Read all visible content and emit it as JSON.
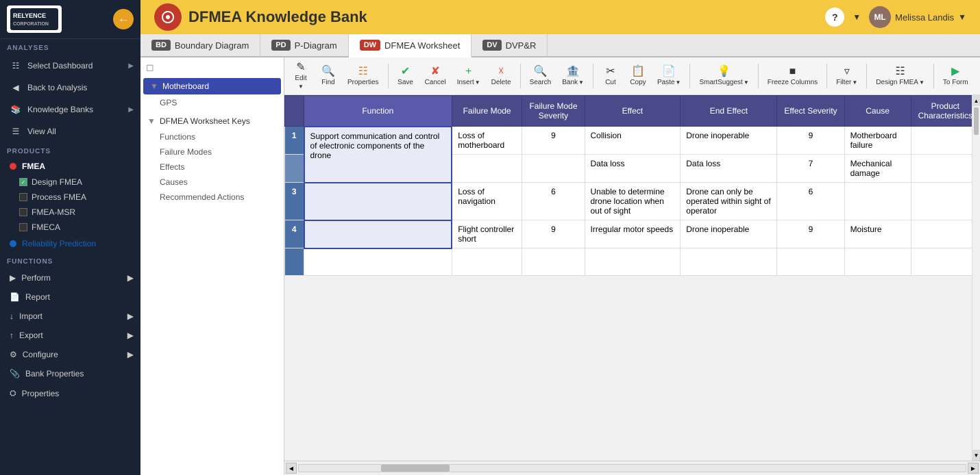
{
  "app": {
    "title": "DFMEA Knowledge Bank",
    "logo_text": "RELYENCE CORPORATION"
  },
  "user": {
    "name": "Melissa Landis",
    "avatar_color": "#8d6e63"
  },
  "sidebar": {
    "analyses_label": "ANALYSES",
    "select_dashboard": "Select Dashboard",
    "back_to_analysis": "Back to Analysis",
    "knowledge_banks": "Knowledge Banks",
    "view_all": "View All",
    "products_label": "PRODUCTS",
    "fmea_label": "FMEA",
    "design_fmea": "Design FMEA",
    "process_fmea": "Process FMEA",
    "fmea_msr": "FMEA-MSR",
    "fmeca": "FMECA",
    "reliability_prediction": "Reliability Prediction",
    "functions_label": "FUNCTIONS",
    "perform": "Perform",
    "report": "Report",
    "import": "Import",
    "export": "Export",
    "configure": "Configure",
    "bank_properties": "Bank Properties",
    "properties": "Properties"
  },
  "tabs": [
    {
      "badge": "BD",
      "label": "Boundary Diagram",
      "badge_class": "bd"
    },
    {
      "badge": "PD",
      "label": "P-Diagram",
      "badge_class": "pd"
    },
    {
      "badge": "DW",
      "label": "DFMEA Worksheet",
      "badge_class": "dw",
      "active": true
    },
    {
      "badge": "DV",
      "label": "DVP&R",
      "badge_class": "dv"
    }
  ],
  "toolbar": {
    "edit": "Edit",
    "find": "Find",
    "properties": "Properties",
    "save": "Save",
    "cancel": "Cancel",
    "insert": "Insert",
    "delete": "Delete",
    "search": "Search",
    "bank": "Bank",
    "cut": "Cut",
    "copy": "Copy",
    "paste": "Paste",
    "smart_suggest": "SmartSuggest",
    "freeze_columns": "Freeze Columns",
    "filter": "Filter",
    "design_fmea": "Design FMEA",
    "to_form": "To Form"
  },
  "tree": {
    "items": [
      {
        "label": "Motherboard",
        "level": 0,
        "selected": true
      },
      {
        "label": "GPS",
        "level": 1
      },
      {
        "label": "DFMEA Worksheet Keys",
        "level": 0
      },
      {
        "label": "Functions",
        "level": 1
      },
      {
        "label": "Failure Modes",
        "level": 1
      },
      {
        "label": "Effects",
        "level": 1
      },
      {
        "label": "Causes",
        "level": 1
      },
      {
        "label": "Recommended Actions",
        "level": 1
      }
    ]
  },
  "table": {
    "columns": [
      {
        "label": "Function"
      },
      {
        "label": "Failure Mode"
      },
      {
        "label": "Failure Mode Severity"
      },
      {
        "label": "Effect"
      },
      {
        "label": "End Effect"
      },
      {
        "label": "Effect Severity"
      },
      {
        "label": "Cause"
      },
      {
        "label": "Product Characteristics"
      }
    ],
    "rows": [
      {
        "num": 1,
        "function": "Support communication and control of electronic components of the drone",
        "failure_mode": "Loss of motherboard",
        "severity": "9",
        "effect": "Collision",
        "end_effect": "Drone inoperable",
        "effect_severity": "9",
        "cause": "Motherboard failure",
        "prod_char": ""
      },
      {
        "num": "",
        "function": "",
        "failure_mode": "",
        "severity": "",
        "effect": "Data loss",
        "end_effect": "Data loss",
        "effect_severity": "7",
        "cause": "Mechanical damage",
        "prod_char": ""
      },
      {
        "num": 3,
        "function": "",
        "failure_mode": "Loss of navigation",
        "severity": "6",
        "effect": "Unable to determine drone location when out of sight",
        "end_effect": "Drone can only be operated within sight of operator",
        "effect_severity": "6",
        "cause": "",
        "prod_char": ""
      },
      {
        "num": 4,
        "function": "",
        "failure_mode": "Flight controller short",
        "severity": "9",
        "effect": "Irregular motor speeds",
        "end_effect": "Drone inoperable",
        "effect_severity": "9",
        "cause": "Moisture",
        "prod_char": ""
      }
    ]
  }
}
